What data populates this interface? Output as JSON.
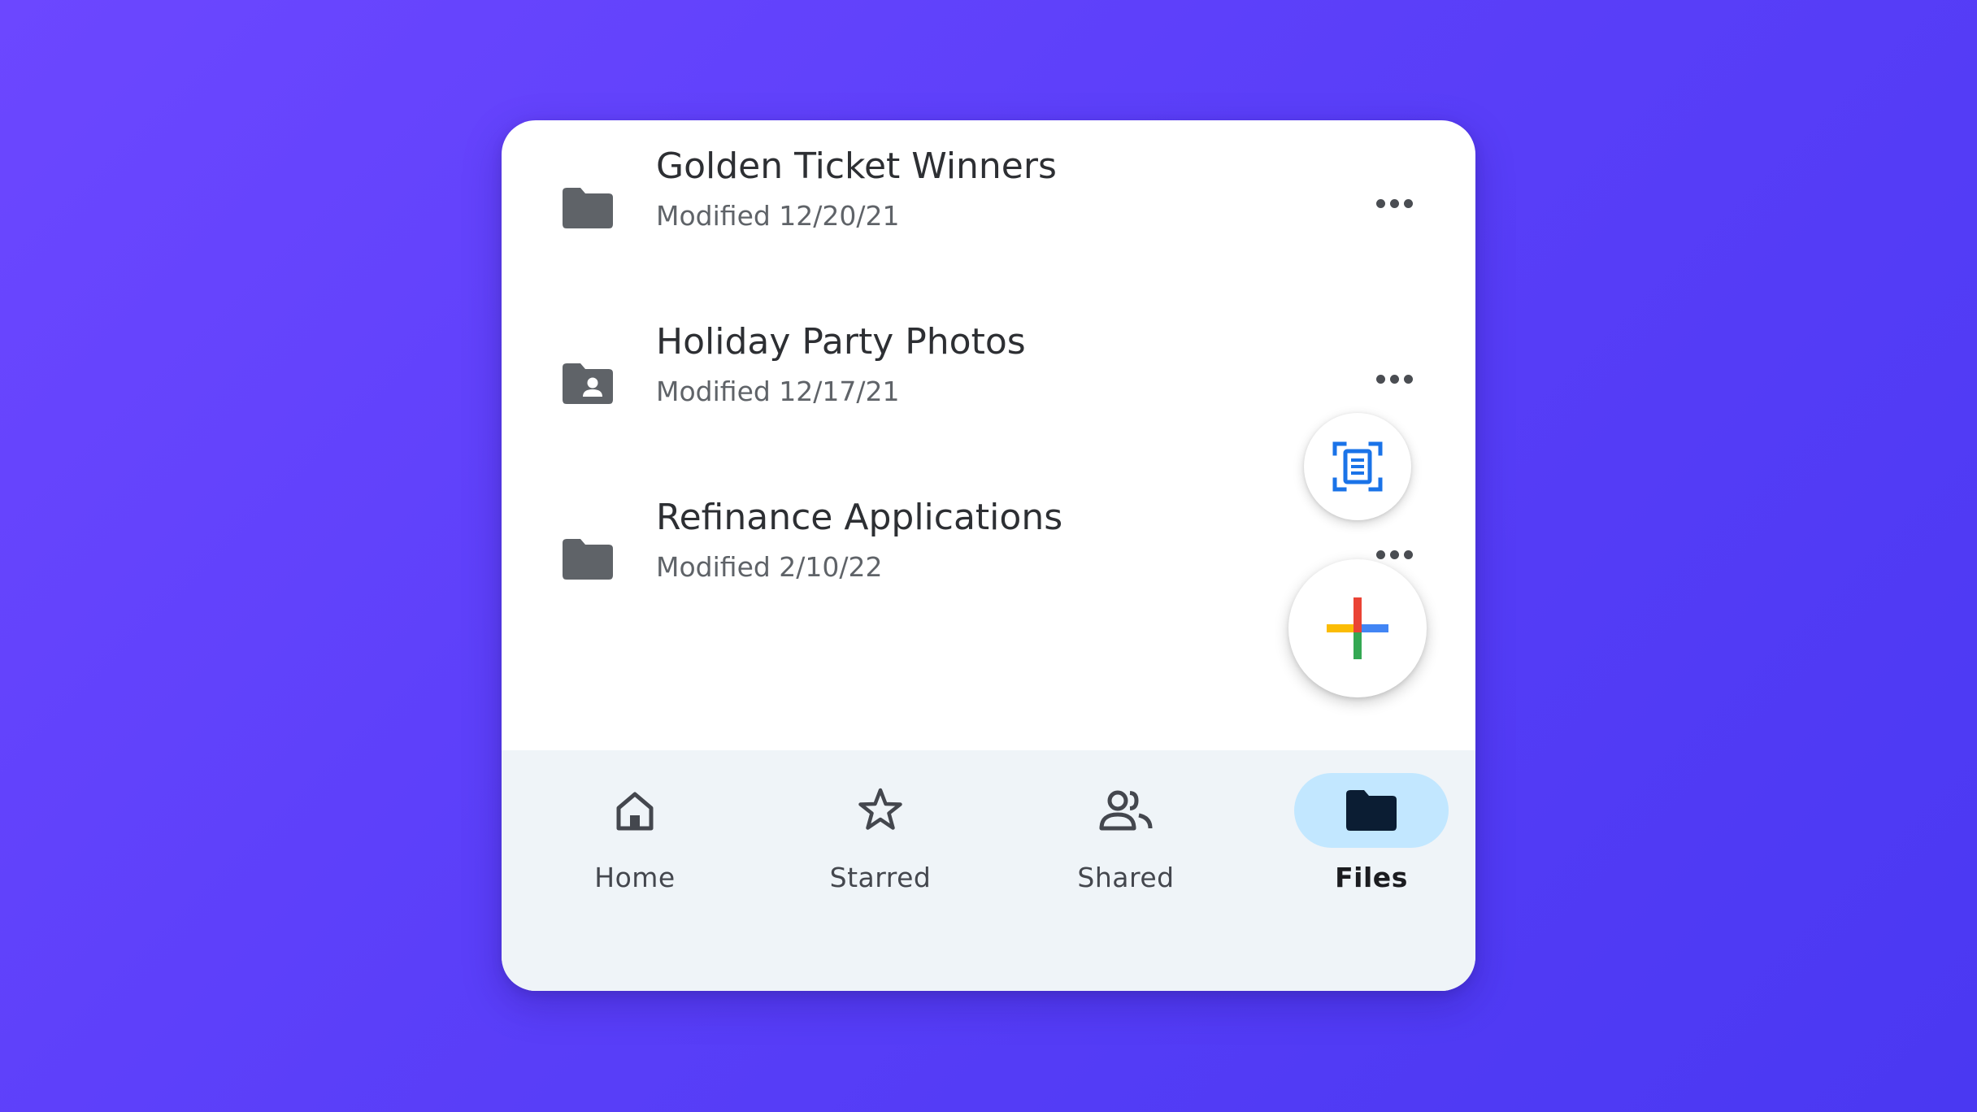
{
  "files": [
    {
      "name": "Golden Ticket Winners",
      "modified": "Modified 12/20/21",
      "icon": "folder-icon"
    },
    {
      "name": "Holiday Party Photos",
      "modified": "Modified 12/17/21",
      "icon": "shared-folder-icon"
    },
    {
      "name": "Refinance Applications",
      "modified": "Modified 2/10/22",
      "icon": "folder-icon"
    }
  ],
  "fabs": {
    "scan_icon": "document-scan-icon",
    "new_icon": "plus-icon"
  },
  "nav": {
    "items": [
      {
        "label": "Home",
        "icon": "home-icon",
        "active": false
      },
      {
        "label": "Starred",
        "icon": "star-icon",
        "active": false
      },
      {
        "label": "Shared",
        "icon": "people-icon",
        "active": false
      },
      {
        "label": "Files",
        "icon": "folder-icon",
        "active": true
      }
    ]
  },
  "colors": {
    "background_start": "#6c47ff",
    "background_end": "#4a38f2",
    "card": "#ffffff",
    "nav_background": "#eff4f8",
    "active_pill": "#c2e7ff",
    "icon_gray": "#5f6368",
    "scan_blue": "#1a73e8",
    "google_red": "#ea4335",
    "google_blue": "#4285f4",
    "google_yellow": "#fbbc04",
    "google_green": "#34a853"
  }
}
